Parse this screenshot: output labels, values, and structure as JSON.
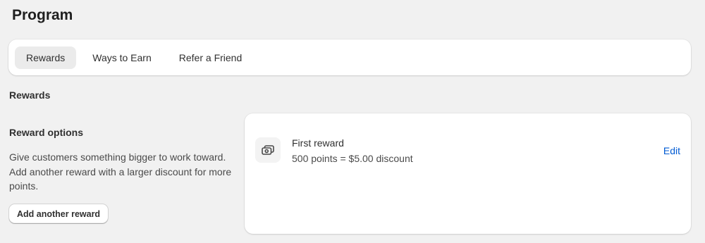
{
  "page": {
    "title": "Program"
  },
  "tabs": [
    {
      "label": "Rewards",
      "active": true
    },
    {
      "label": "Ways to Earn",
      "active": false
    },
    {
      "label": "Refer a Friend",
      "active": false
    }
  ],
  "section": {
    "heading": "Rewards"
  },
  "reward_options": {
    "title": "Reward options",
    "description": "Give customers something bigger to work toward. Add another reward with a larger discount for more points.",
    "add_button_label": "Add another reward"
  },
  "rewards": [
    {
      "icon": "discount-cash-icon",
      "name": "First reward",
      "detail": "500 points = $5.00 discount",
      "edit_label": "Edit"
    }
  ],
  "colors": {
    "background": "#f1f1f1",
    "card": "#ffffff",
    "active_tab": "#ebebeb",
    "link": "#005bd3"
  }
}
